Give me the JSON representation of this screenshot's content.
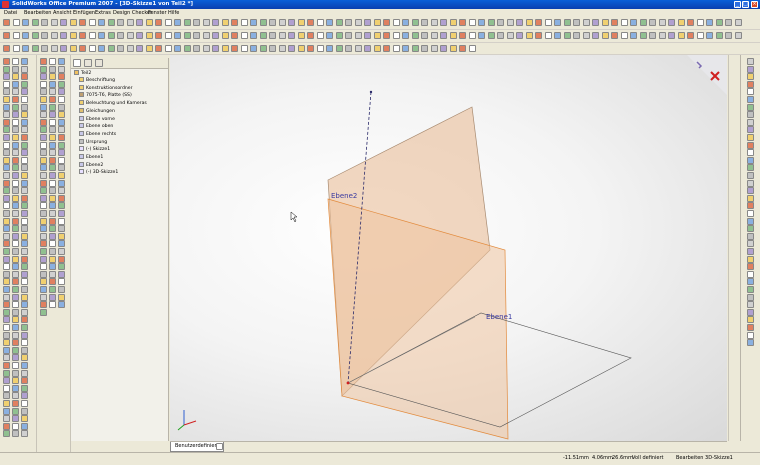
{
  "window": {
    "title": "SolidWorks Office Premium 2007 - [3D-Skizze1 von Teil2 *]",
    "minimize": "_",
    "maximize": "□",
    "close": "×"
  },
  "menu": [
    "Datei",
    "Bearbeiten",
    "Ansicht",
    "Einfügen",
    "Extras",
    "Design Checker",
    "Fenster",
    "Hilfe"
  ],
  "feature_tree": {
    "root": "Teil2",
    "items": [
      "Beschriftung",
      "Konstruktionsordner",
      "7075-T6, Platte (SS)",
      "Beleuchtung und Kameras",
      "Gleichungen",
      "Ebene vorne",
      "Ebene oben",
      "Ebene rechts",
      "Ursprung",
      "(-) Skizze1",
      "Ebene1",
      "Ebene2",
      "(-) 3D-Skizze1"
    ]
  },
  "viewport": {
    "plane_label_1": "Ebene2",
    "plane_label_2": "Ebene1"
  },
  "bottom_tab": "Benutzerdefiniert",
  "statusbar": {
    "x": "-11.51mm",
    "y": "4.06mm",
    "z": "26.6mm",
    "state": "Voll definiert",
    "mode": "Bearbeiten 3D-Skizze1"
  },
  "colors": {
    "plane_fill": "#e8b890",
    "plane_edge": "#e28a3c",
    "sketch_line": "#555555",
    "axis_line": "#2a2a6a"
  }
}
